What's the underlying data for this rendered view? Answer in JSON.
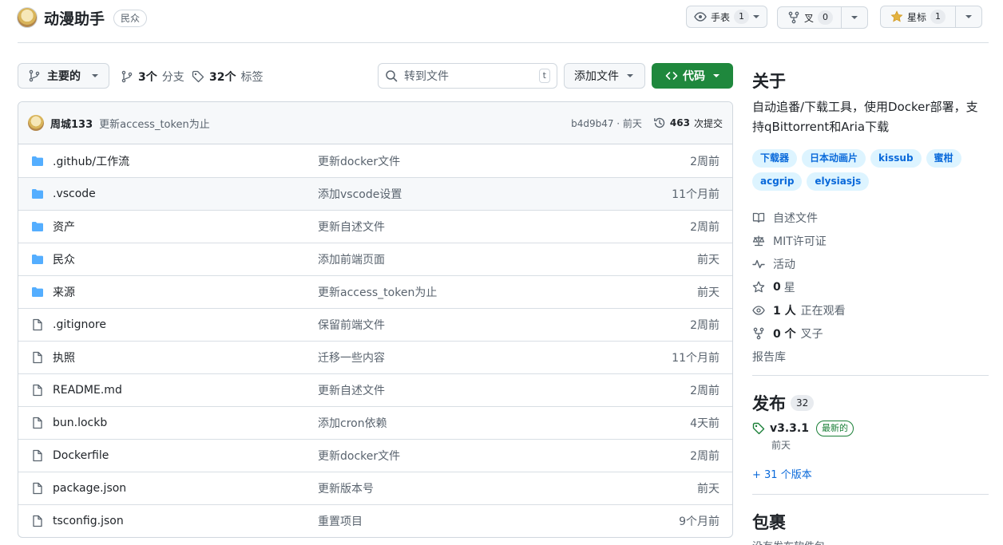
{
  "repo": {
    "name": "动漫助手",
    "visibility": "民众"
  },
  "header_actions": {
    "watch": {
      "label": "手表",
      "count": "1"
    },
    "fork": {
      "label": "叉",
      "count": "0"
    },
    "star": {
      "label": "星标",
      "count": "1"
    }
  },
  "toolbar": {
    "branch_label": "主要的",
    "branches_count": "3个",
    "branches_label": "分支",
    "tags_count": "32个",
    "tags_label": "标签",
    "search_placeholder": "转到文件",
    "search_kbd": "t",
    "add_file_label": "添加文件",
    "code_label": "代码"
  },
  "last_commit": {
    "author": "周城133",
    "message": "更新access_token为止",
    "hash_time": "b4d9b47 · 前天",
    "count": "463",
    "count_label": "次提交"
  },
  "files": [
    {
      "type": "dir",
      "name": ".github/工作流",
      "message": "更新docker文件",
      "time": "2周前"
    },
    {
      "type": "dir",
      "name": ".vscode",
      "message": "添加vscode设置",
      "time": "11个月前"
    },
    {
      "type": "dir",
      "name": "资产",
      "message": "更新自述文件",
      "time": "2周前"
    },
    {
      "type": "dir",
      "name": "民众",
      "message": "添加前端页面",
      "time": "前天"
    },
    {
      "type": "dir",
      "name": "来源",
      "message": "更新access_token为止",
      "time": "前天"
    },
    {
      "type": "file",
      "name": ".gitignore",
      "message": "保留前端文件",
      "time": "2周前"
    },
    {
      "type": "file",
      "name": "执照",
      "message": "迁移一些内容",
      "time": "11个月前"
    },
    {
      "type": "file",
      "name": "README.md",
      "message": "更新自述文件",
      "time": "2周前"
    },
    {
      "type": "file",
      "name": "bun.lockb",
      "message": "添加cron依赖",
      "time": "4天前"
    },
    {
      "type": "file",
      "name": "Dockerfile",
      "message": "更新docker文件",
      "time": "2周前"
    },
    {
      "type": "file",
      "name": "package.json",
      "message": "更新版本号",
      "time": "前天"
    },
    {
      "type": "file",
      "name": "tsconfig.json",
      "message": "重置项目",
      "time": "9个月前"
    }
  ],
  "about": {
    "heading": "关于",
    "description": "自动追番/下载工具，使用Docker部署，支持qBittorrent和Aria下载",
    "topics": [
      "下载器",
      "日本动画片",
      "kissub",
      "蜜柑",
      "acgrip",
      "elysiasjs"
    ],
    "readme_label": "自述文件",
    "license_label": "MIT许可证",
    "activity_label": "活动",
    "stars_count": "0",
    "stars_label": "星",
    "watching_count": "1 人",
    "watching_label": "正在观看",
    "forks_count": "0 个",
    "forks_label": "叉子",
    "report_label": "报告库"
  },
  "releases": {
    "heading": "发布",
    "count": "32",
    "latest_tag": "v3.3.1",
    "latest_badge": "最新的",
    "latest_date": "前天",
    "more_label": "+ 31 个版本"
  },
  "packages": {
    "heading": "包裹",
    "subtitle": "没有发布软件包"
  },
  "colors": {
    "accent": "#0969da",
    "code_button": "#1f883d",
    "folder": "#54aeff"
  }
}
